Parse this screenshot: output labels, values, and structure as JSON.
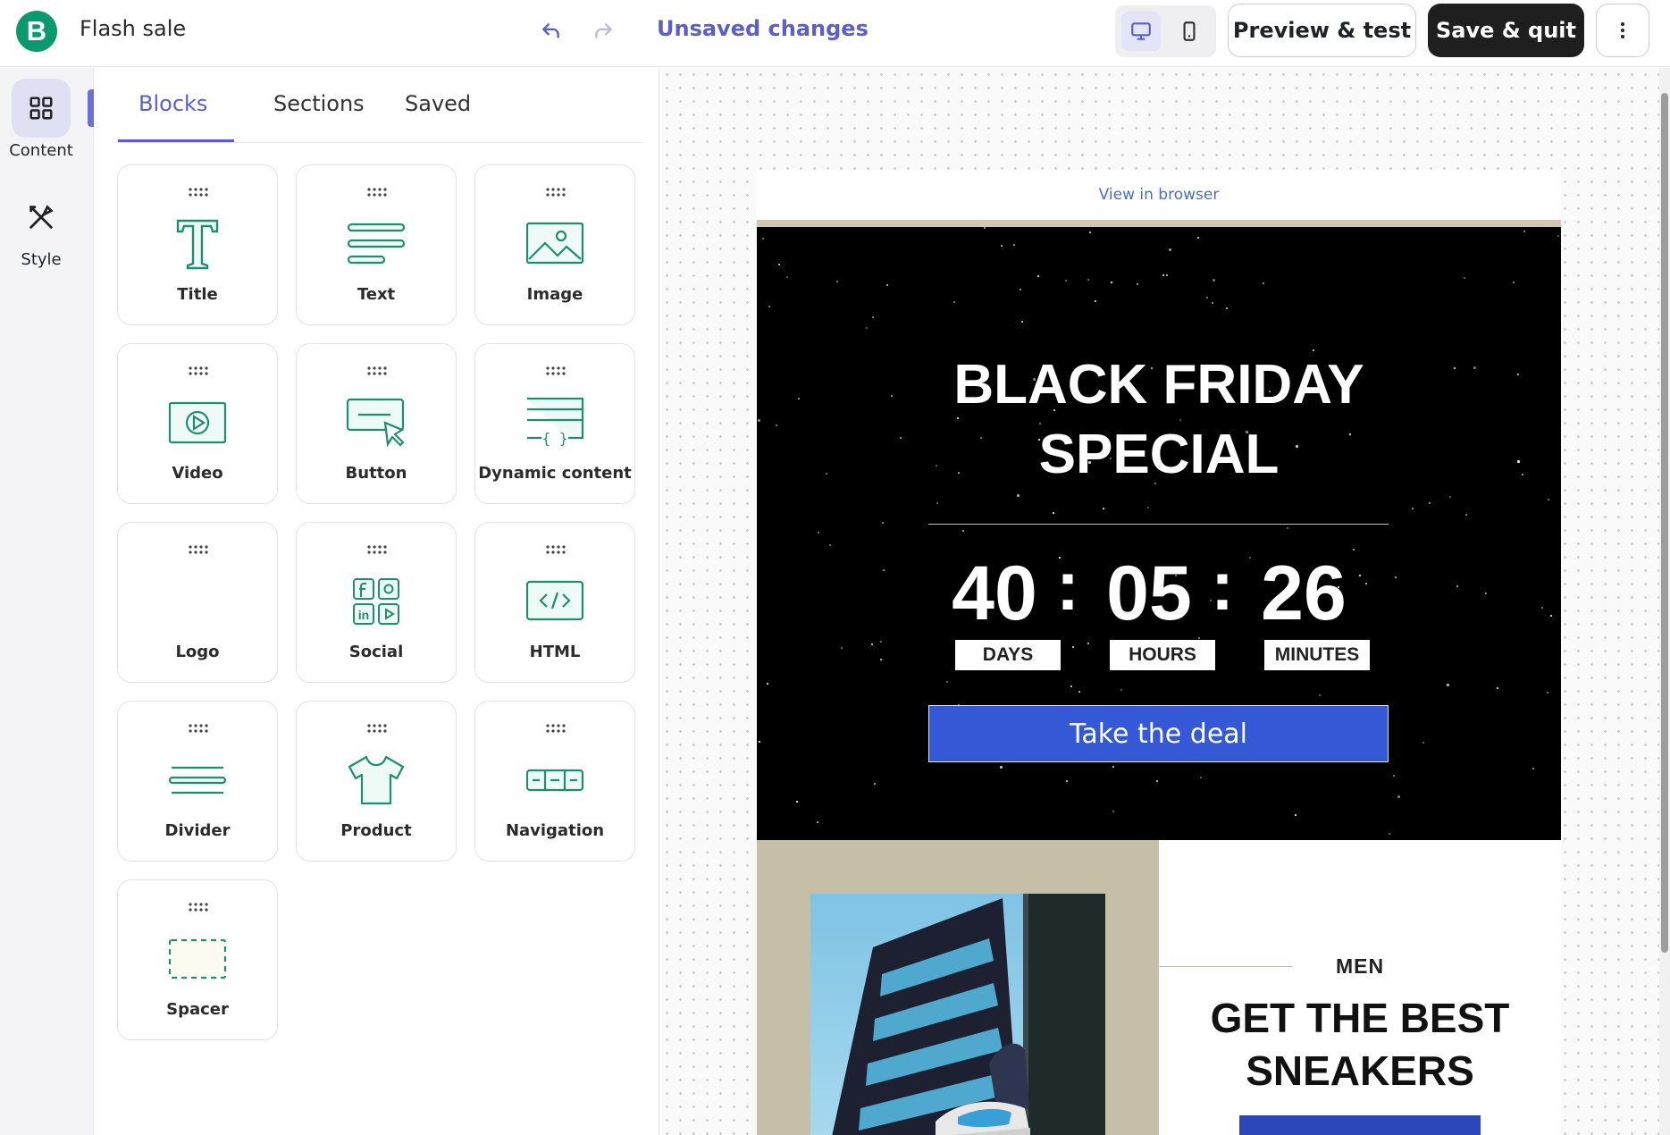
{
  "header": {
    "logo_letter": "B",
    "title": "Flash sale",
    "unsaved": "Unsaved changes",
    "preview_label": "Preview & test",
    "save_label": "Save & quit"
  },
  "rail": {
    "items": [
      {
        "label": "Content",
        "icon": "grid-icon"
      },
      {
        "label": "Style",
        "icon": "paint-tools-icon"
      }
    ]
  },
  "panel": {
    "tabs": [
      "Blocks",
      "Sections",
      "Saved"
    ],
    "active_tab": "Blocks",
    "blocks": [
      {
        "label": "Title",
        "icon": "title-icon"
      },
      {
        "label": "Text",
        "icon": "text-icon"
      },
      {
        "label": "Image",
        "icon": "image-icon"
      },
      {
        "label": "Video",
        "icon": "video-icon"
      },
      {
        "label": "Button",
        "icon": "button-icon"
      },
      {
        "label": "Dynamic content",
        "icon": "dynamic-content-icon"
      },
      {
        "label": "Logo",
        "icon": "logo-icon"
      },
      {
        "label": "Social",
        "icon": "social-icon"
      },
      {
        "label": "HTML",
        "icon": "html-icon"
      },
      {
        "label": "Divider",
        "icon": "divider-icon"
      },
      {
        "label": "Product",
        "icon": "product-icon"
      },
      {
        "label": "Navigation",
        "icon": "navigation-icon"
      },
      {
        "label": "Spacer",
        "icon": "spacer-icon"
      }
    ]
  },
  "email": {
    "view_in_browser": "View in browser",
    "hero_line1": "BLACK FRIDAY",
    "hero_line2": "SPECIAL",
    "countdown": {
      "days": "40",
      "hours": "05",
      "minutes": "26",
      "separator": ":"
    },
    "units": {
      "days": "DAYS",
      "hours": "HOURS",
      "minutes": "MINUTES"
    },
    "cta": "Take the deal",
    "section_kicker": "MEN",
    "section_title_line1": "GET THE BEST",
    "section_title_line2": "SNEAKERS"
  },
  "colors": {
    "brand_green": "#0b996e",
    "accent_purple": "#5b5fc7",
    "icon_teal": "#1e8e6e",
    "cta_blue": "#3558d6",
    "tan": "#c6bfa8"
  }
}
